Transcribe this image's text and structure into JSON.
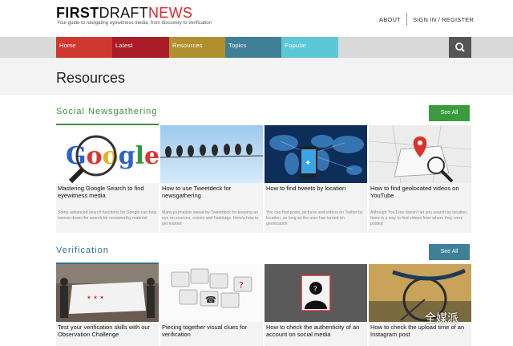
{
  "header": {
    "logo_first": "FIRST",
    "logo_draft": "DRAFT",
    "logo_news": "NEWS",
    "tagline": "Your guide to navigating eyewitness media, from discovery to verification",
    "about": "ABOUT",
    "signin": "SIGN IN / REGISTER"
  },
  "nav": {
    "items": [
      {
        "label": "Home",
        "color": "#d0372e"
      },
      {
        "label": "Latest",
        "color": "#a81d27"
      },
      {
        "label": "Resources",
        "color": "#b0902e"
      },
      {
        "label": "Topics",
        "color": "#3f7f98"
      },
      {
        "label": "Popular",
        "color": "#5cc7d6"
      }
    ],
    "search_icon": "search-icon"
  },
  "page": {
    "title": "Resources"
  },
  "sections": [
    {
      "heading": "Social Newsgathering",
      "see_all": "See All",
      "see_all_color": "#3b9a3b",
      "cards": [
        {
          "title": "Mastering Google Search to find eyewitness media",
          "desc": "Some advanced search functions for Google can help narrow down the search for newsworthy material",
          "image": "google-logo-magnifier"
        },
        {
          "title": "How to use Tweetdeck for newsgathering",
          "desc": "Many journalists swear by Tweetdeck for keeping an eye on sources, events and hashtags. Here's how to get started",
          "image": "birds-on-wire"
        },
        {
          "title": "How to find tweets by location",
          "desc": "You can find posts, pictures and videos on Twitter by location, as long as the user has turned on geolocation",
          "image": "phone-world-map"
        },
        {
          "title": "How to find geolocated videos on YouTube",
          "desc": "Although YouTube doesn't let you search by location, there is a way to find videos from where they were posted",
          "image": "map-pin-magnifier"
        }
      ]
    },
    {
      "heading": "Verification",
      "see_all": "See All",
      "see_all_color": "#3f7f98",
      "cards": [
        {
          "title": "Test your verification skills with our Observation Challenge",
          "desc": "",
          "image": "protest-crowd"
        },
        {
          "title": "Piecing together visual clues for verification",
          "desc": "",
          "image": "puzzle-pieces"
        },
        {
          "title": "How to check the authenticity of an account on social media",
          "desc": "",
          "image": "unknown-profile"
        },
        {
          "title": "How to check the upload time of an Instagram post",
          "desc": "",
          "image": "bicycle-closeup"
        }
      ]
    }
  ],
  "watermark": "全媒派"
}
